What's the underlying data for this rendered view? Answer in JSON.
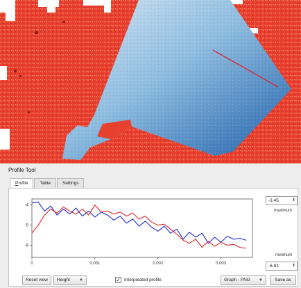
{
  "panel": {
    "title": "Profile Tool"
  },
  "tabs": [
    {
      "label": "Profile",
      "accel": "P",
      "rest": "rofile",
      "active": true
    },
    {
      "label": "Table",
      "active": false
    },
    {
      "label": "Settings",
      "active": false
    }
  ],
  "chart_data": {
    "type": "line",
    "xlim": [
      0,
      0.0035
    ],
    "ylim": [
      -6.6,
      -3.7
    ],
    "x_ticks": [
      0,
      0.001,
      0.002,
      0.003
    ],
    "x_tick_labels": [
      "0",
      "0.001",
      "0.002",
      "0.003"
    ],
    "y_ticks": [
      -4,
      -5,
      -6
    ],
    "y_tick_labels": [
      "-4",
      "-5",
      "-6"
    ],
    "grid": false,
    "series": [
      {
        "color": "#1f2bd6",
        "x": [
          0,
          0.0001,
          0.0002,
          0.0003,
          0.0004,
          0.0005,
          0.0006,
          0.0007,
          0.0008,
          0.0009,
          0.001,
          0.0011,
          0.0012,
          0.0013,
          0.0014,
          0.0015,
          0.0016,
          0.0017,
          0.0018,
          0.0019,
          0.002,
          0.0021,
          0.0022,
          0.0023,
          0.0024,
          0.0025,
          0.0026,
          0.0027,
          0.0028,
          0.0029,
          0.003,
          0.0031,
          0.0032,
          0.0033,
          0.0034
        ],
        "y": [
          -3.9,
          -3.85,
          -4.3,
          -4.05,
          -4.5,
          -4.2,
          -4.45,
          -4.15,
          -4.55,
          -4.3,
          -4.6,
          -4.35,
          -4.5,
          -4.75,
          -4.55,
          -4.9,
          -4.7,
          -5.05,
          -4.8,
          -5.1,
          -5.3,
          -5.05,
          -5.4,
          -5.2,
          -5.7,
          -5.35,
          -5.6,
          -5.4,
          -5.9,
          -5.6,
          -5.85,
          -5.55,
          -5.7,
          -5.65,
          -5.75
        ]
      },
      {
        "color": "#e0262a",
        "x": [
          0,
          0.0001,
          0.0002,
          0.0003,
          0.0004,
          0.0005,
          0.0006,
          0.0007,
          0.0008,
          0.0009,
          0.001,
          0.0011,
          0.0012,
          0.0013,
          0.0014,
          0.0015,
          0.0016,
          0.0017,
          0.0018,
          0.0019,
          0.002,
          0.0021,
          0.0022,
          0.0023,
          0.0024,
          0.0025,
          0.0026,
          0.0027,
          0.0028,
          0.0029,
          0.003,
          0.0031,
          0.0032,
          0.0033,
          0.0034
        ],
        "y": [
          -5.4,
          -5.0,
          -4.5,
          -4.2,
          -4.4,
          -4.1,
          -4.3,
          -4.45,
          -4.2,
          -4.5,
          -4.0,
          -4.35,
          -4.3,
          -4.45,
          -4.35,
          -4.55,
          -4.4,
          -4.7,
          -4.55,
          -4.85,
          -5.0,
          -4.95,
          -5.2,
          -5.45,
          -5.75,
          -5.9,
          -5.7,
          -6.1,
          -5.8,
          -6.05,
          -5.85,
          -6.0,
          -5.95,
          -6.1,
          -6.15
        ]
      }
    ]
  },
  "range": {
    "max_value": "-3.45",
    "max_label": "maximum",
    "min_label": "minimum",
    "min_value": "-6.81"
  },
  "toolbar": {
    "reset_label": "Reset view",
    "mode_value": "Height",
    "interpolated_label": "Interpolated profile",
    "interpolated_checked": true,
    "check_mark": "✓",
    "format_value": "Graph - PNG",
    "save_label": "Save as"
  },
  "colors": {
    "map_red": "#e8402f",
    "map_blue_light": "#c9def0",
    "map_blue_dark": "#1f5fa8",
    "profile_line": "#e0262a"
  }
}
